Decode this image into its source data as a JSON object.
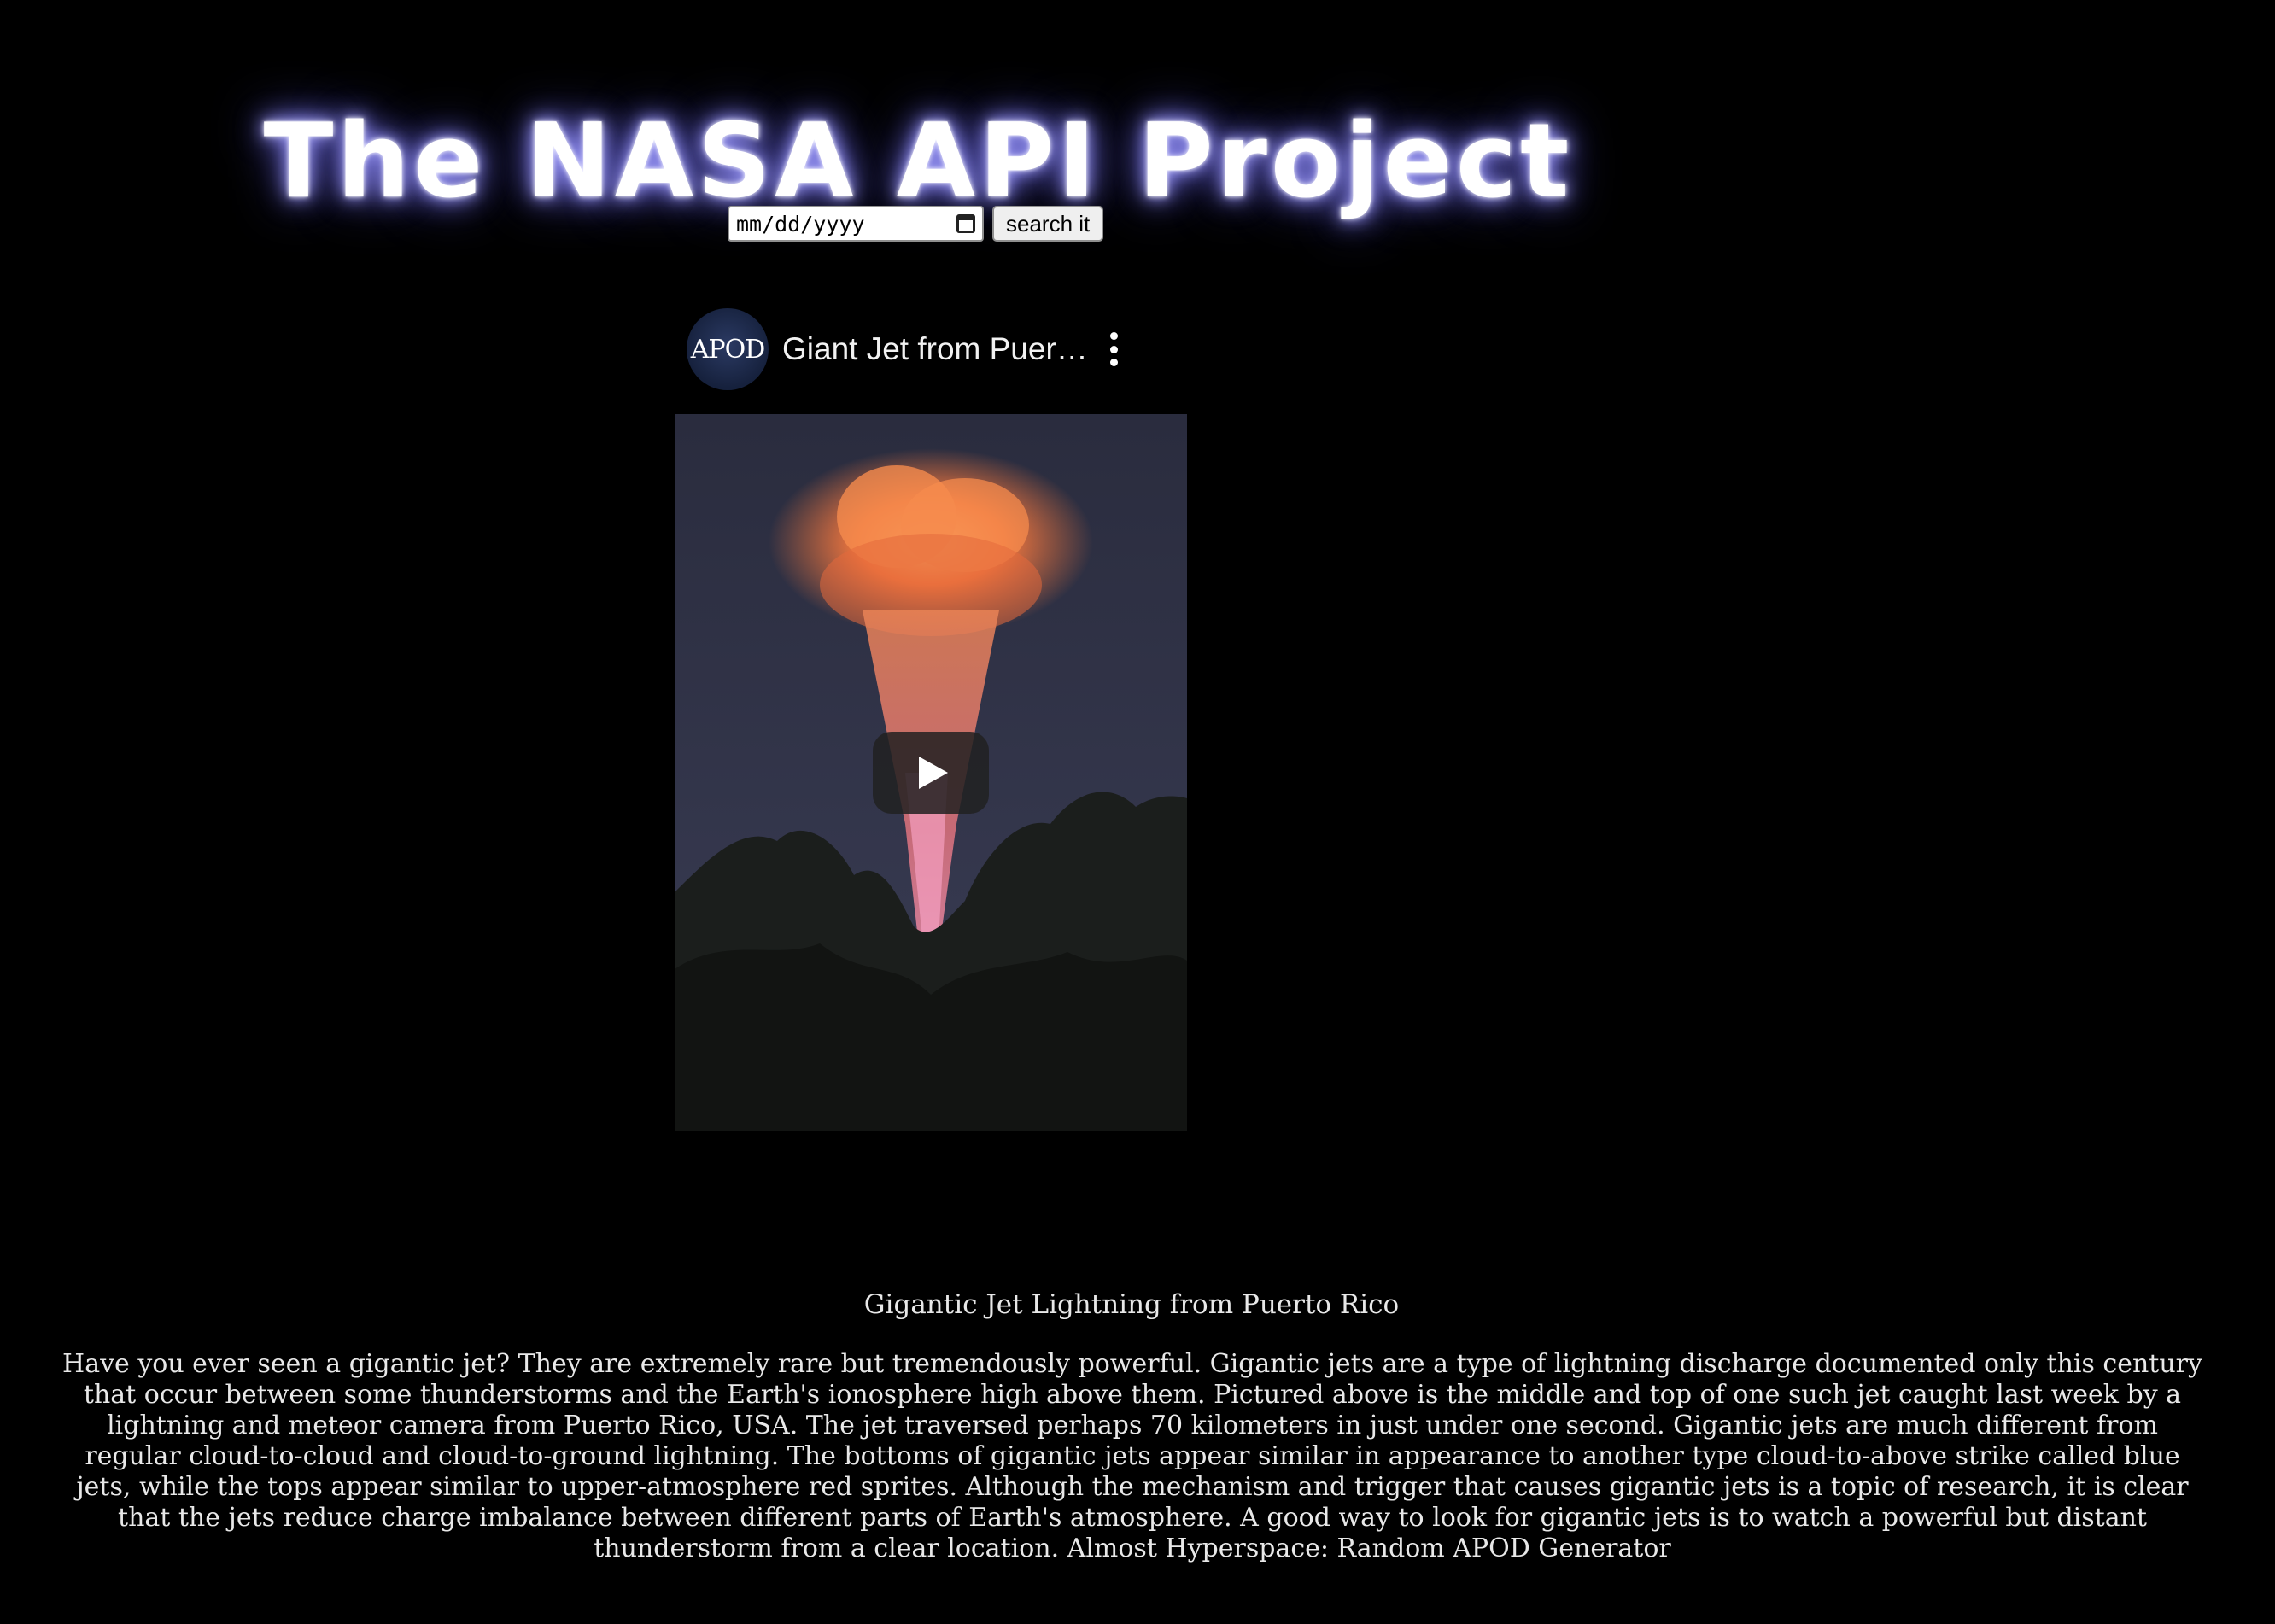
{
  "header": {
    "title": "The NASA API Project"
  },
  "search": {
    "date_placeholder": "mm/dd/yyyy",
    "button_label": "search it"
  },
  "video": {
    "channel_avatar_text": "APOD",
    "title": "Giant Jet from Puert...",
    "more_icon": "more-vertical-icon",
    "play_icon": "play-icon"
  },
  "apod": {
    "title": "Gigantic Jet Lightning from Puerto Rico",
    "explanation": "Have you ever seen a gigantic jet? They are extremely rare but tremendously powerful. Gigantic jets are a type of lightning discharge documented only this century that occur between some thunderstorms and the Earth's ionosphere high above them. Pictured above is the middle and top of one such jet caught last week by a lightning and meteor camera from Puerto Rico, USA. The jet traversed perhaps 70 kilometers in just under one second. Gigantic jets are much different from regular cloud-to-cloud and cloud-to-ground lightning. The bottoms of gigantic jets appear similar in appearance to another type cloud-to-above strike called blue jets, while the tops appear similar to upper-atmosphere red sprites. Although the mechanism and trigger that causes gigantic jets is a topic of research, it is clear that the jets reduce charge imbalance between different parts of Earth's atmosphere. A good way to look for gigantic jets is to watch a powerful but distant thunderstorm from a clear location. Almost Hyperspace: Random APOD Generator"
  },
  "colors": {
    "background": "#000000",
    "title_glow": "#7f7cf0",
    "text": "#e8e8e8"
  }
}
